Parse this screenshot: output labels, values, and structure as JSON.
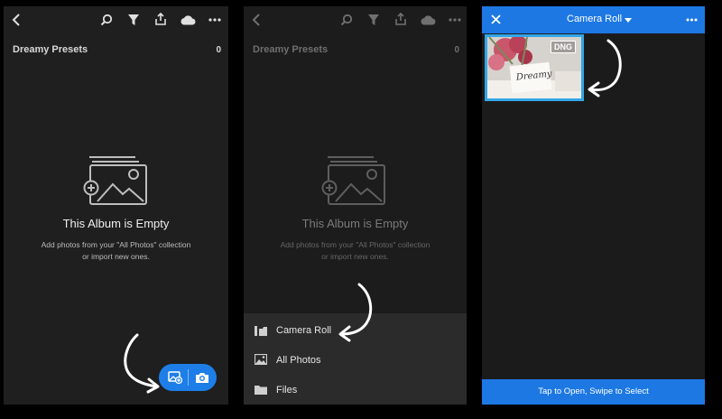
{
  "panel1": {
    "icons": [
      "back-icon",
      "search-icon",
      "filter-icon",
      "share-icon",
      "cloud-icon",
      "more-icon"
    ],
    "album_title": "Dreamy Presets",
    "album_count": "0",
    "empty_title": "This Album is Empty",
    "empty_line1": "Add photos from your \"All Photos\" collection",
    "empty_line2": "or import new ones.",
    "fab_icons": [
      "add-photo-icon",
      "camera-icon"
    ]
  },
  "panel2": {
    "album_title": "Dreamy Presets",
    "album_count": "0",
    "empty_title": "This Album is Empty",
    "empty_line1": "Add photos from your \"All Photos\" collection",
    "empty_line2": "or import new ones.",
    "import_menu": [
      {
        "label": "Camera Roll",
        "icon": "camera-roll-icon"
      },
      {
        "label": "All Photos",
        "icon": "photos-icon"
      },
      {
        "label": "Files",
        "icon": "folder-icon"
      }
    ]
  },
  "panel3": {
    "title": "Camera Roll",
    "thumbnail_badge": "DNG",
    "thumbnail_text": "Dreamy",
    "footer": "Tap to Open, Swipe to Select"
  },
  "colors": {
    "accent_blue": "#1d78e3",
    "selection_border": "#33a6e6",
    "panel_bg": "#1f1f1f"
  }
}
